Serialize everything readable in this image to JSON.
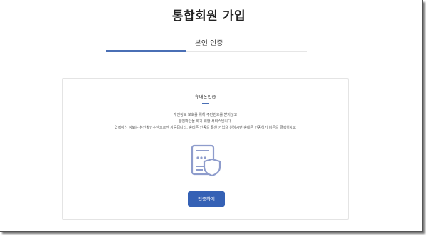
{
  "page": {
    "title": "통합회원 가입"
  },
  "steps": {
    "current_label": "본인 인증",
    "progress_fraction": 0.4
  },
  "card": {
    "title": "휴대폰인증",
    "description_lines": [
      "개인정보 보호를 위해 주민번호를 받지않고",
      "본인확인을 하기 위한 서비스입니다.",
      "입력하신 정보는 본인확인수단으로만 사용됩니다. 휴대폰 인증을 통한 가입을 원하시면 휴대폰 인증하기 버튼을 클릭하세요"
    ],
    "icon": "phone-shield-icon",
    "button_label": "인증하기"
  },
  "colors": {
    "accent": "#3561b5",
    "progress": "#4a6fb5",
    "icon_stroke": "#8e9ccc"
  }
}
